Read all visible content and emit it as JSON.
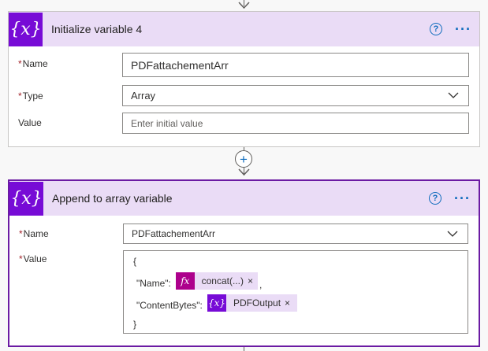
{
  "card1": {
    "icon_glyph": "{x}",
    "title": "Initialize variable 4",
    "help_glyph": "?",
    "more_glyph": "···",
    "name_label": "Name",
    "name_value": "PDFattachementArr",
    "type_label": "Type",
    "type_value": "Array",
    "value_label": "Value",
    "value_placeholder": "Enter initial value"
  },
  "connector": {
    "plus_glyph": "+"
  },
  "card2": {
    "icon_glyph": "{x}",
    "title": "Append to array variable",
    "help_glyph": "?",
    "more_glyph": "···",
    "name_label": "Name",
    "name_value": "PDFattachementArr",
    "value_label": "Value",
    "json_open": "{",
    "name_key": "\"Name\":",
    "token1_icon": "fx",
    "token1_label": "concat(...)",
    "token_close": "×",
    "comma": ",",
    "content_key": "\"ContentBytes\":",
    "token2_icon": "{x}",
    "token2_label": "PDFOutput",
    "json_close": "}"
  },
  "required_mark": "*",
  "colors": {
    "header_bg": "#eadcf6",
    "variable_icon": "#770bd6",
    "expression_icon": "#ad008c",
    "selected_border": "#6b1ba3",
    "link_blue": "#0f6cbd"
  }
}
